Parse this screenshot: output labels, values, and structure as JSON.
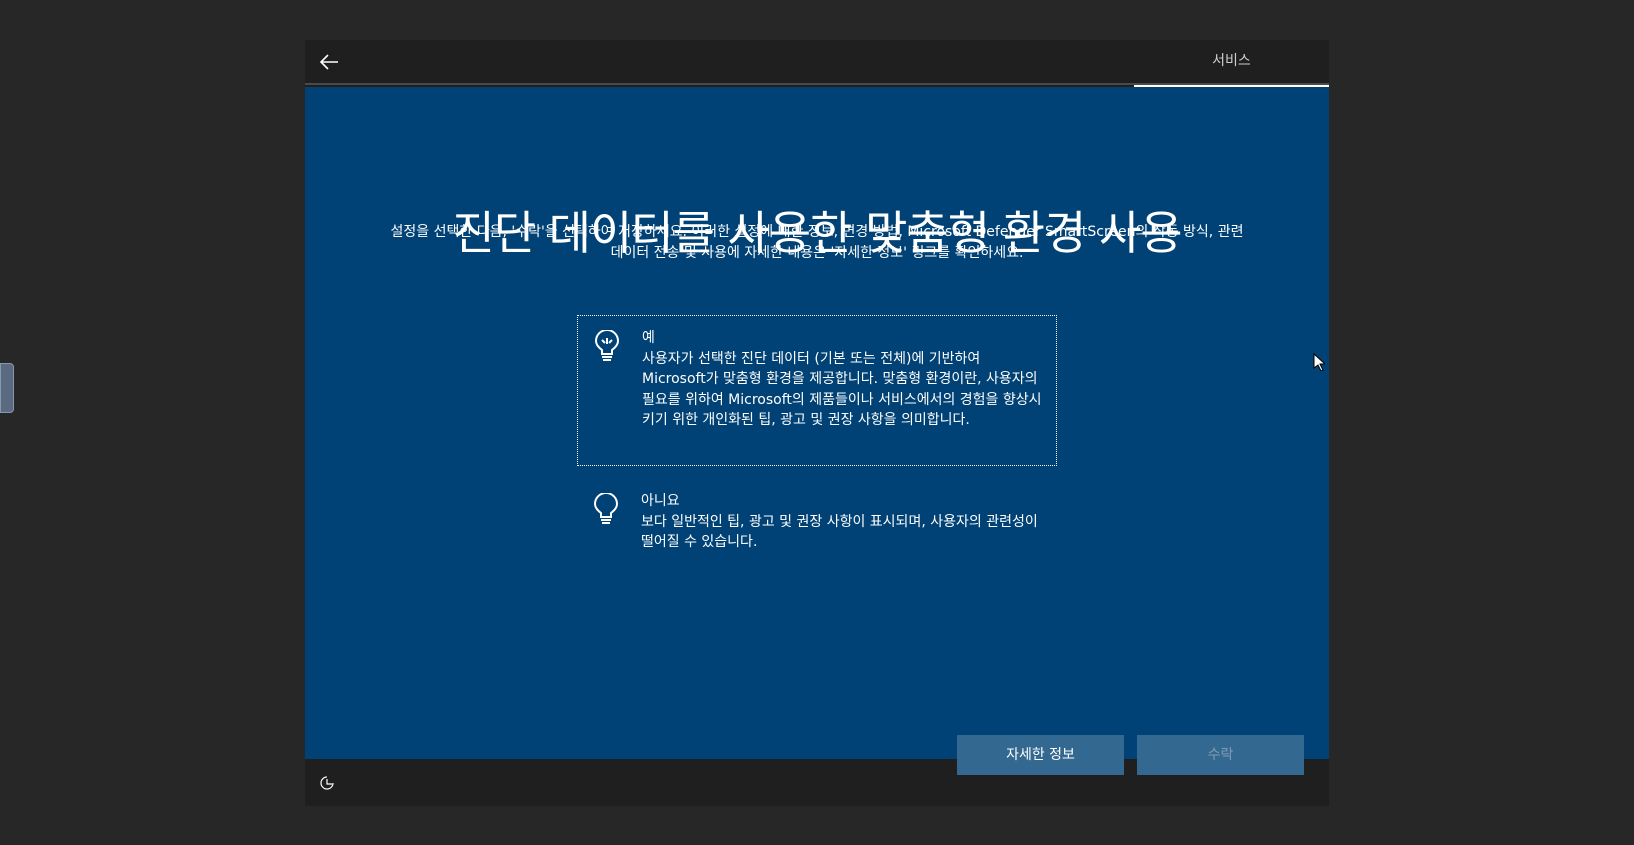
{
  "header": {
    "tab_label": "서비스"
  },
  "main": {
    "title": "진단 데이터를 사용한 맞춤형 환경 사용",
    "subtitle_line1": "설정을 선택한 다음, '수락'을 선택하여 저장하세요. 이러한 설정에 대한 정보, 변경 방법, Microsoft Defender SmartScreen의 작동 방식, 관련",
    "subtitle_line2": "데이터 전송 및 사용에 자세한 내용은 '자세한 정보' 링크를 확인하세요.",
    "options": [
      {
        "title": "예",
        "description": "사용자가 선택한 진단 데이터 (기본 또는 전체)에 기반하여 Microsoft가 맞춤형 환경을 제공합니다. 맞춤형 환경이란, 사용자의 필요를 위하여 Microsoft의 제품들이나 서비스에서의 경험을 향상시키기 위한 개인화된 팁, 광고 및 권장 사항을 의미합니다.",
        "selected": true
      },
      {
        "title": "아니요",
        "description": "보다 일반적인 팁, 광고 및 권장 사항이 표시되며, 사용자의 관련성이 떨어질 수 있습니다.",
        "selected": false
      }
    ],
    "buttons": {
      "learn_more": "자세한 정보",
      "accept": "수락"
    }
  },
  "colors": {
    "background": "#004275",
    "button": "#336891",
    "frame": "#1f1f1f"
  }
}
